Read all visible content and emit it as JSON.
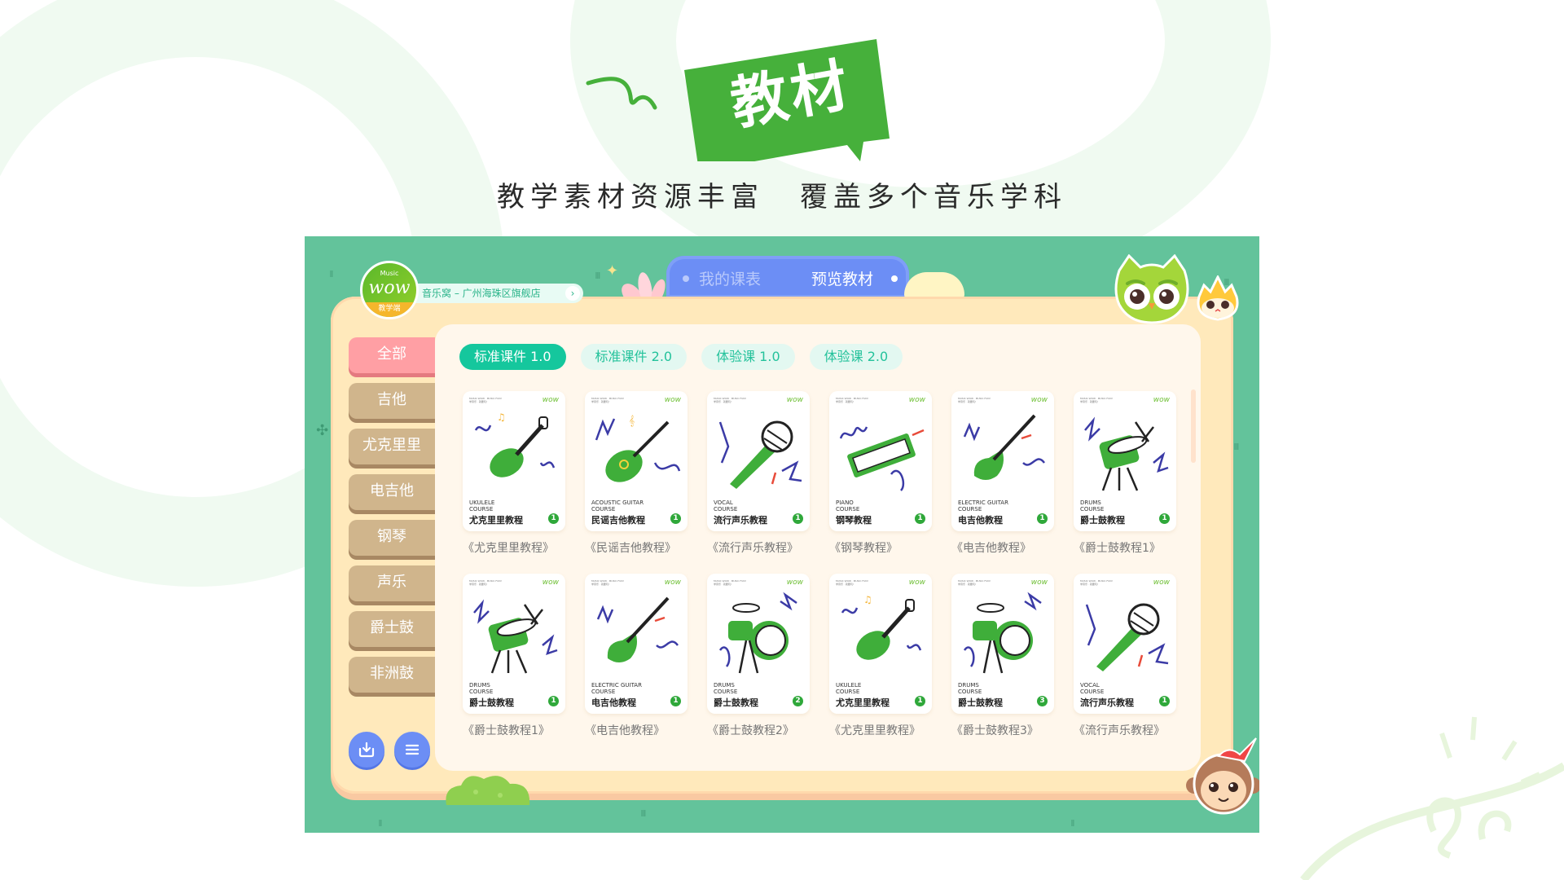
{
  "hero": {
    "badge": "教材",
    "subtitle_left": "教学素材资源丰富",
    "subtitle_right": "覆盖多个音乐学科",
    "badge_color": "#46b03b"
  },
  "app": {
    "logo": {
      "top": "Music",
      "word": "wow",
      "band": "教学端"
    },
    "store": "音乐窝 – 广州海珠区旗舰店",
    "top_tabs": [
      {
        "label": "我的课表",
        "active": false
      },
      {
        "label": "预览教材",
        "active": true
      }
    ],
    "sidebar": [
      {
        "label": "全部",
        "active": true
      },
      {
        "label": "吉他"
      },
      {
        "label": "尤克里里"
      },
      {
        "label": "电吉他"
      },
      {
        "label": "钢琴"
      },
      {
        "label": "声乐"
      },
      {
        "label": "爵士鼓"
      },
      {
        "label": "非洲鼓"
      }
    ],
    "sidebar_buttons": {
      "download": "download-icon",
      "menu": "menu-icon"
    },
    "chips": [
      {
        "label": "标准课件 1.0",
        "active": true
      },
      {
        "label": "标准课件 2.0"
      },
      {
        "label": "体验课 1.0"
      },
      {
        "label": "体验课 2.0"
      }
    ],
    "card_header": {
      "line1": "MUSIC WOW · MUSIC FUN!",
      "line2": "学音乐 · 就要玩!",
      "logo": "wow"
    },
    "cards": [
      {
        "art": "ukulele",
        "en1": "UKULELE",
        "en2": "COURSE",
        "cn": "尤克里里教程",
        "num": "1",
        "title": "《尤克里里教程》"
      },
      {
        "art": "guitar",
        "en1": "ACOUSTIC GUITAR",
        "en2": "COURSE",
        "cn": "民谣吉他教程",
        "num": "1",
        "title": "《民谣吉他教程》"
      },
      {
        "art": "mic",
        "en1": "VOCAL",
        "en2": "COURSE",
        "cn": "流行声乐教程",
        "num": "1",
        "title": "《流行声乐教程》"
      },
      {
        "art": "piano",
        "en1": "PIANO",
        "en2": "COURSE",
        "cn": "钢琴教程",
        "num": "1",
        "title": "《钢琴教程》"
      },
      {
        "art": "eguitar",
        "en1": "ELECTRIC GUITAR",
        "en2": "COURSE",
        "cn": "电吉他教程",
        "num": "1",
        "title": "《电吉他教程》"
      },
      {
        "art": "drum",
        "en1": "DRUMS",
        "en2": "COURSE",
        "cn": "爵士鼓教程",
        "num": "1",
        "title": "《爵士鼓教程1》"
      },
      {
        "art": "drum",
        "en1": "DRUMS",
        "en2": "COURSE",
        "cn": "爵士鼓教程",
        "num": "1",
        "title": "《爵士鼓教程1》"
      },
      {
        "art": "eguitar",
        "en1": "ELECTRIC GUITAR",
        "en2": "COURSE",
        "cn": "电吉他教程",
        "num": "1",
        "title": "《电吉他教程》"
      },
      {
        "art": "drumkit",
        "en1": "DRUMS",
        "en2": "COURSE",
        "cn": "爵士鼓教程",
        "num": "2",
        "title": "《爵士鼓教程2》"
      },
      {
        "art": "ukulele",
        "en1": "UKULELE",
        "en2": "COURSE",
        "cn": "尤克里里教程",
        "num": "1",
        "title": "《尤克里里教程》"
      },
      {
        "art": "drumkit",
        "en1": "DRUMS",
        "en2": "COURSE",
        "cn": "爵士鼓教程",
        "num": "3",
        "title": "《爵士鼓教程3》"
      },
      {
        "art": "mic",
        "en1": "VOCAL",
        "en2": "COURSE",
        "cn": "流行声乐教程",
        "num": "1",
        "title": "《流行声乐教程》"
      }
    ],
    "colors": {
      "frame": "#63c39b",
      "panel": "#ffe9bb",
      "content": "#fff7ec",
      "tab_bar": "#6c8ef5",
      "chip_active": "#15c79d",
      "sidebar_active": "#ff9fa4",
      "sidebar_item": "#d0b58c"
    }
  }
}
